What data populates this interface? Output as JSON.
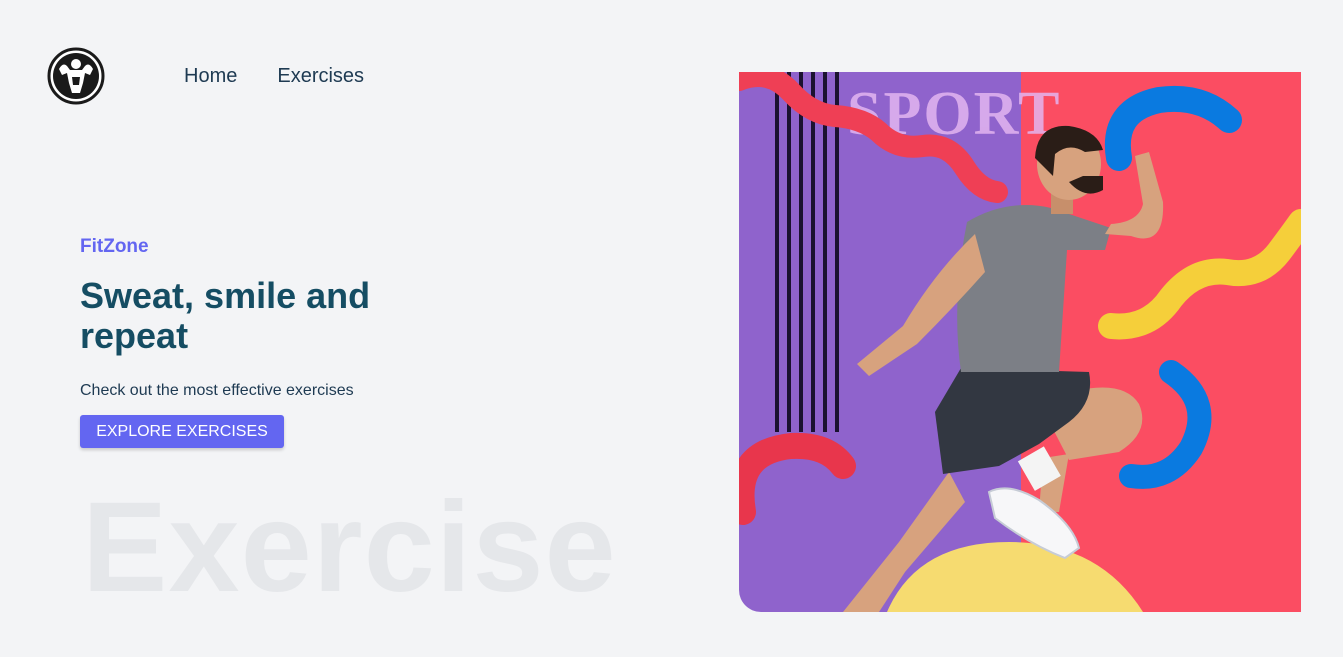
{
  "nav": {
    "logo_icon": "bodybuilder-logo-icon",
    "links": [
      {
        "label": "Home"
      },
      {
        "label": "Exercises"
      }
    ]
  },
  "hero": {
    "brand": "FitZone",
    "headline": "Sweat, smile and repeat",
    "subtext": "Check out the most effective exercises",
    "cta_label": "Explore Exercises",
    "watermark": "Exercise"
  },
  "banner": {
    "image": "sprinting-man-sport-banner",
    "sport_text": "SPORT"
  },
  "colors": {
    "accent": "#6366f1",
    "heading": "#154d63",
    "background": "#f3f4f6",
    "banner_purple": "#8f63cc",
    "banner_red": "#fb4d62"
  }
}
